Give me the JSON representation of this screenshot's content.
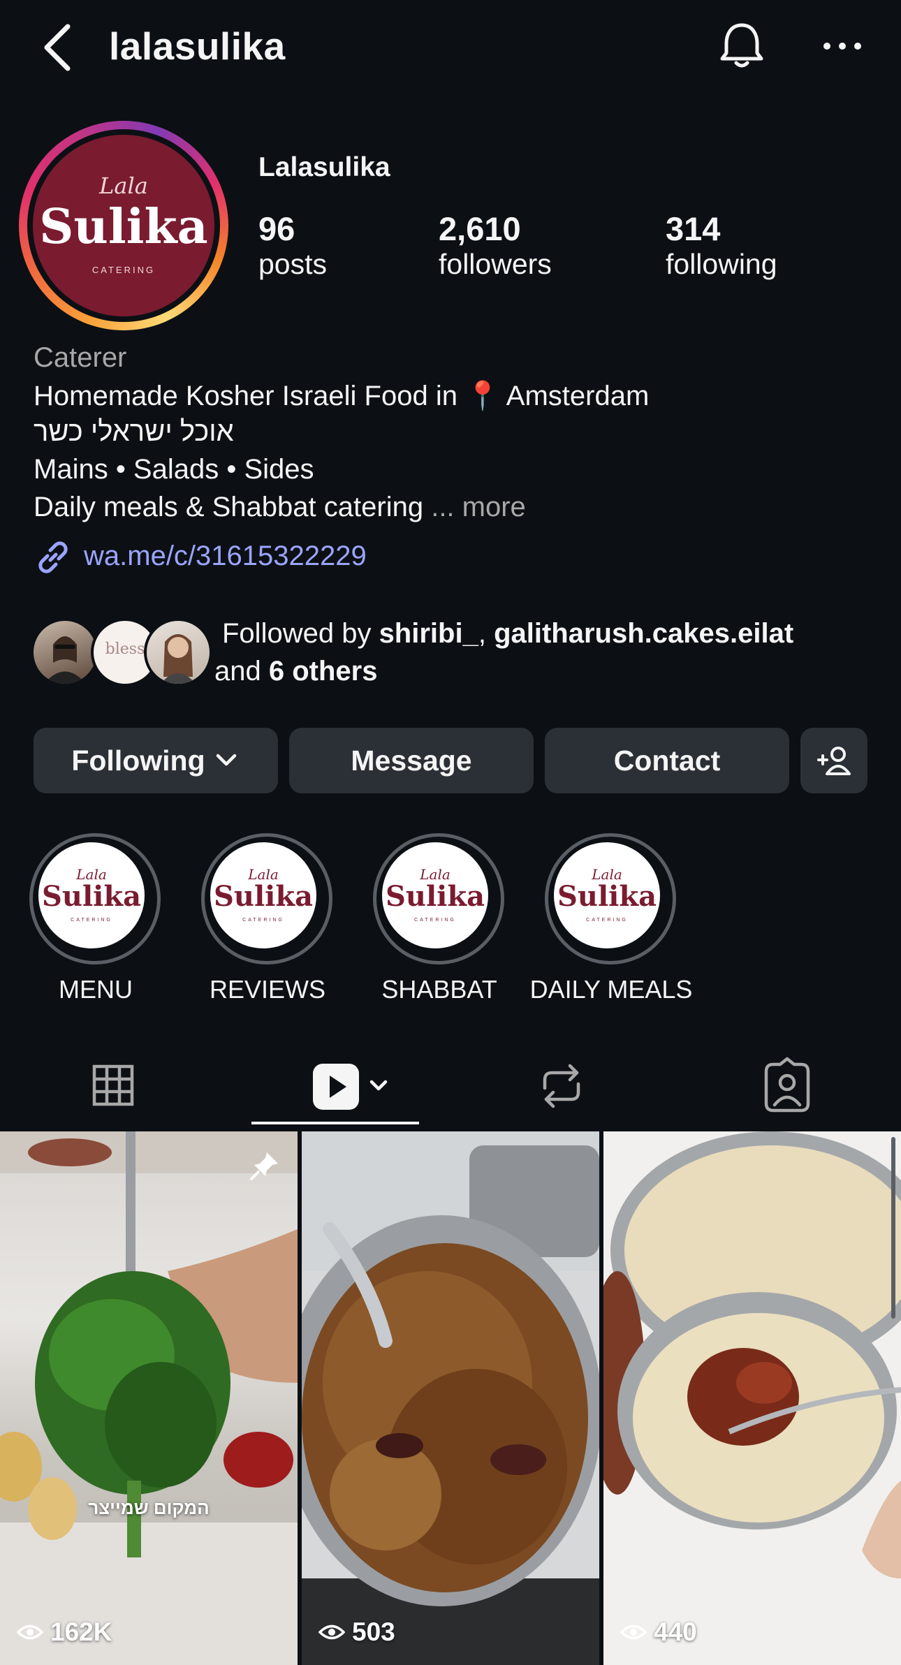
{
  "header": {
    "username": "lalasulika",
    "back_icon": "chevron-left-icon",
    "bell_icon": "bell-icon",
    "more_icon": "more-horizontal-icon"
  },
  "profile": {
    "display_name": "Lalasulika",
    "avatar_logo": {
      "small": "Lala",
      "big": "Sulika",
      "tiny": "CATERING"
    },
    "stats": [
      {
        "value": "96",
        "label": "posts"
      },
      {
        "value": "2,610",
        "label": "followers"
      },
      {
        "value": "314",
        "label": "following"
      }
    ],
    "category": "Caterer",
    "bio": {
      "line1_before": "Homemade Kosher Israeli Food in ",
      "line1_icon": "📍",
      "line1_after": " Amsterdam",
      "line2": "אוכל ישראלי כשר",
      "line3": "Mains • Salads • Sides",
      "line4": "Daily meals & Shabbat catering",
      "more": "... more"
    },
    "link": "wa.me/c/31615322229",
    "followed_by": {
      "prefix": "Followed by ",
      "user1": "shiribi_",
      "sep": ", ",
      "user2": "galitharush.cakes.eilat",
      "and": " and ",
      "others": "6 others",
      "mid_avatar_text": "bless"
    }
  },
  "actions": {
    "following": "Following",
    "message": "Message",
    "contact": "Contact"
  },
  "highlights": [
    {
      "label": "MENU"
    },
    {
      "label": "REVIEWS"
    },
    {
      "label": "SHABBAT"
    },
    {
      "label": "DAILY MEALS"
    }
  ],
  "highlight_logo": {
    "small": "Lala",
    "big": "Sulika",
    "tiny": "CATERING"
  },
  "tabs": [
    {
      "name": "grid",
      "icon": "grid-icon"
    },
    {
      "name": "reels",
      "icon": "reels-icon",
      "active": true
    },
    {
      "name": "reposts",
      "icon": "repost-icon"
    },
    {
      "name": "tagged",
      "icon": "tagged-icon"
    }
  ],
  "posts": [
    {
      "views": "162K",
      "overlay_text": "המקום שמייצר",
      "pinned": true
    },
    {
      "views": "503"
    },
    {
      "views": "440"
    }
  ],
  "colors": {
    "background": "#0c1014",
    "button": "#2b3036",
    "link": "#9ba4ff",
    "brand": "#7a1b30"
  }
}
